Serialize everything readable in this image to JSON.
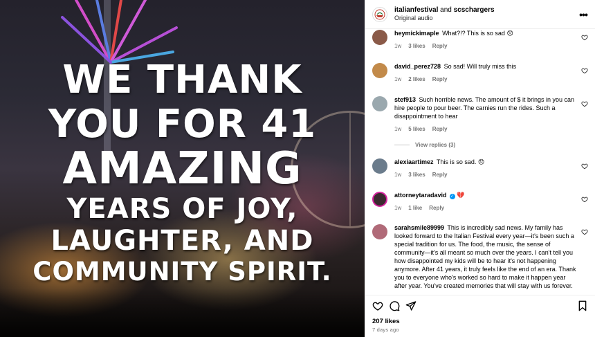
{
  "media": {
    "headline": [
      "WE THANK",
      "YOU FOR 41",
      "AMAZING",
      "YEARS OF JOY,",
      "LAUGHTER, AND",
      "COMMUNITY SPIRIT."
    ]
  },
  "header": {
    "author1": "italianfestival",
    "and_text": "and",
    "author2": "scschargers",
    "audio": "Original audio",
    "more_icon": "more-horizontal-icon"
  },
  "comments": [
    {
      "user": "heymickimaple",
      "text": "What?!? This is so sad 😞",
      "time": "1w",
      "likes": "3 likes",
      "reply": "Reply",
      "avatar_color": "#8a5a48"
    },
    {
      "user": "david_perez728",
      "text": "So sad! Will truly miss this",
      "time": "1w",
      "likes": "2 likes",
      "reply": "Reply",
      "avatar_color": "#c28a4a"
    },
    {
      "user": "stef913",
      "text": "Such horrible news. The amount of $ it brings in you can hire people to pour beer. The carnies run the rides. Such a disappointment to hear",
      "time": "1w",
      "likes": "5 likes",
      "reply": "Reply",
      "avatar_color": "#9aa8ae",
      "view_replies": "View replies (3)"
    },
    {
      "user": "alexiaartimez",
      "text": "This is so sad. 😞",
      "time": "1w",
      "likes": "3 likes",
      "reply": "Reply",
      "avatar_color": "#6b7c8c"
    },
    {
      "user": "attorneytaradavid",
      "text": "💔",
      "time": "1w",
      "likes": "1 like",
      "reply": "Reply",
      "avatar_color": "#3b2a30",
      "verified": true
    },
    {
      "user": "sarahsmile89999",
      "text": "This is incredibly sad news. My family has looked forward to the Italian Festival every year—it's been such a special tradition for us. The food, the music, the sense of community—it's all meant so much over the years. I can't tell you how disappointed my kids will be to hear it's not happening anymore. After 41 years, it truly feels like the end of an era. Thank you to everyone who's worked so hard to make it happen year after year. You've created memories that will stay with us forever.",
      "avatar_color": "#b06a78"
    }
  ],
  "footer": {
    "likes": "207 likes",
    "ago": "7 days ago"
  },
  "icons": {
    "like": "heart-icon",
    "comment": "comment-icon",
    "share": "share-icon",
    "save": "bookmark-icon"
  }
}
